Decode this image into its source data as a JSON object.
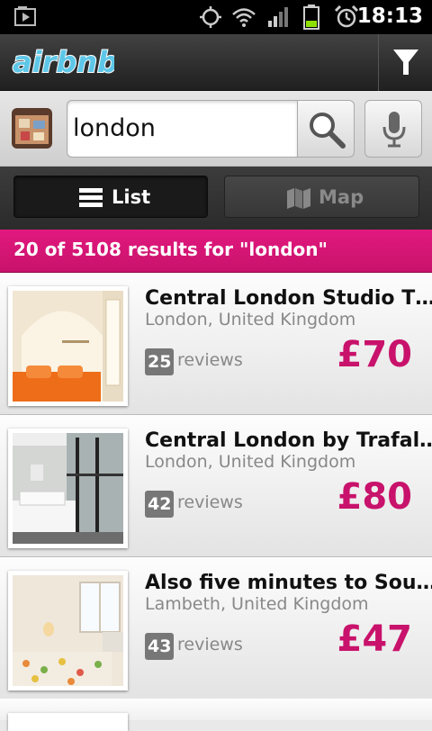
{
  "status_bar": {
    "time": "18:13",
    "icons": [
      "media-play-icon",
      "gps-icon",
      "wifi-icon",
      "signal-icon",
      "battery-icon",
      "alarm-icon"
    ]
  },
  "app_bar": {
    "logo_text": "airbnb",
    "filter_icon": "filter-funnel-icon"
  },
  "search": {
    "value": "london",
    "search_icon": "magnifier-icon",
    "mic_icon": "microphone-icon"
  },
  "view_toggle": {
    "list_label": "List",
    "map_label": "Map",
    "selected": "List"
  },
  "results": {
    "summary": "20 of 5108 results for \"london\""
  },
  "listings": [
    {
      "title": "Central London Studio T…",
      "location": "London, United Kingdom",
      "review_count": "25",
      "reviews_label": "reviews",
      "price": "£70"
    },
    {
      "title": "Central London by Trafal…",
      "location": "London, United Kingdom",
      "review_count": "42",
      "reviews_label": "reviews",
      "price": "£80"
    },
    {
      "title": "Also five minutes to Sou…",
      "location": "Lambeth, United Kingdom",
      "review_count": "43",
      "reviews_label": "reviews",
      "price": "£47"
    }
  ],
  "colors": {
    "accent": "#c8126b",
    "banner": "#e2197f",
    "logo": "#5ec7e8"
  }
}
